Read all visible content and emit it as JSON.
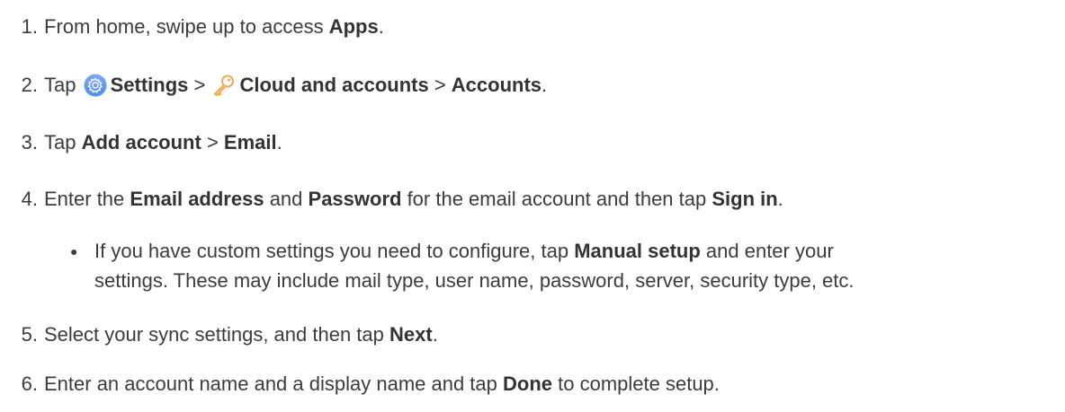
{
  "steps": [
    {
      "number": "1.",
      "parts": [
        {
          "text": "From home, swipe up to access ",
          "bold": false
        },
        {
          "text": "Apps",
          "bold": true
        },
        {
          "text": ".",
          "bold": false
        }
      ]
    },
    {
      "number": "2.",
      "parts": [
        {
          "text": "Tap ",
          "bold": false
        },
        {
          "icon": "settings-gear-icon"
        },
        {
          "text": "Settings",
          "bold": true
        },
        {
          "text": " > ",
          "bold": false
        },
        {
          "icon": "key-icon"
        },
        {
          "text": "Cloud and accounts",
          "bold": true
        },
        {
          "text": " > ",
          "bold": false
        },
        {
          "text": "Accounts",
          "bold": true
        },
        {
          "text": ".",
          "bold": false
        }
      ]
    },
    {
      "number": "3.",
      "parts": [
        {
          "text": "Tap ",
          "bold": false
        },
        {
          "text": "Add account",
          "bold": true
        },
        {
          "text": " > ",
          "bold": false
        },
        {
          "text": "Email",
          "bold": true
        },
        {
          "text": ".",
          "bold": false
        }
      ]
    },
    {
      "number": "4.",
      "parts": [
        {
          "text": "Enter the ",
          "bold": false
        },
        {
          "text": "Email address",
          "bold": true
        },
        {
          "text": " and ",
          "bold": false
        },
        {
          "text": "Password",
          "bold": true
        },
        {
          "text": " for the email account and then tap ",
          "bold": false
        },
        {
          "text": "Sign in",
          "bold": true
        },
        {
          "text": ".",
          "bold": false
        }
      ],
      "sub_bullet": {
        "line1": [
          {
            "text": "If you have custom settings you need to configure, tap ",
            "bold": false
          },
          {
            "text": "Manual setup",
            "bold": true
          },
          {
            "text": " and enter your",
            "bold": false
          }
        ],
        "line2": [
          {
            "text": "settings. These may include mail type, user name, password, server, security type, etc.",
            "bold": false
          }
        ]
      }
    },
    {
      "number": "5.",
      "parts": [
        {
          "text": "Select your sync settings, and then tap ",
          "bold": false
        },
        {
          "text": "Next",
          "bold": true
        },
        {
          "text": ".",
          "bold": false
        }
      ]
    },
    {
      "number": "6.",
      "parts": [
        {
          "text": "Enter an account name and a display name and tap ",
          "bold": false
        },
        {
          "text": "Done",
          "bold": true
        },
        {
          "text": " to complete setup.",
          "bold": false
        }
      ]
    }
  ],
  "colors": {
    "text": "#3c3c3c",
    "settings_icon_bg": "#4f8ef7",
    "key_icon": "#f2a84b"
  }
}
